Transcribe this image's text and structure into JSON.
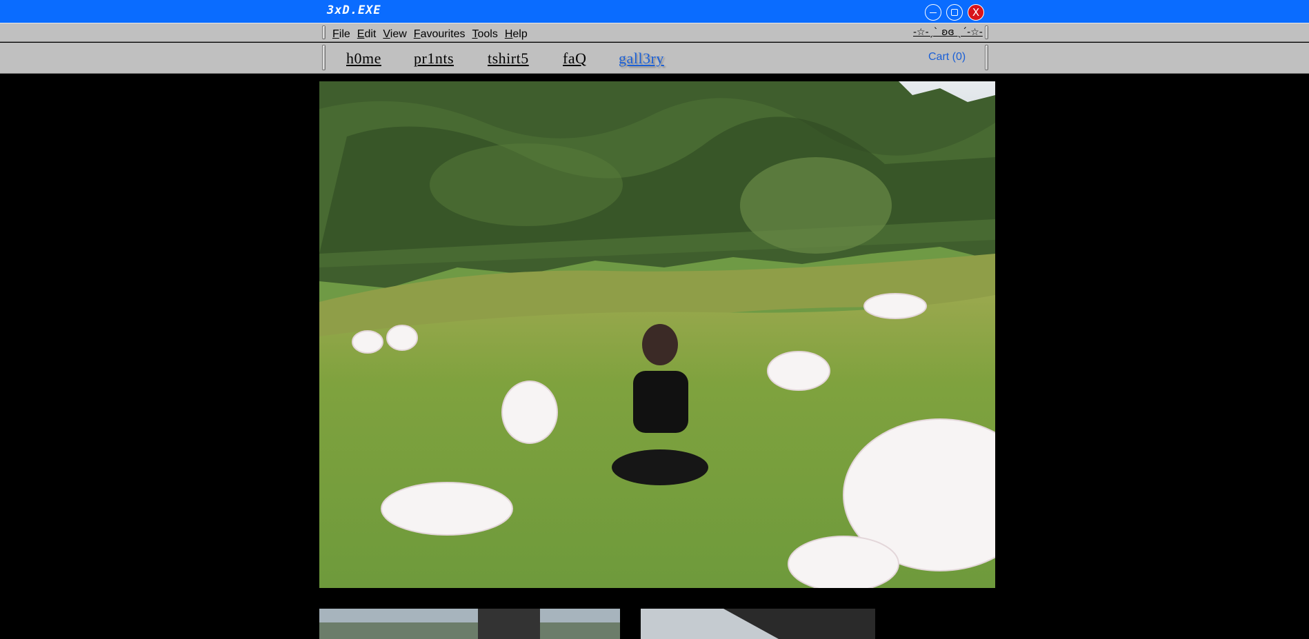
{
  "window": {
    "title": "3xD.EXE",
    "minimize_glyph": "",
    "close_glyph": "X"
  },
  "menubar": {
    "items": [
      {
        "accel": "F",
        "rest": "ile"
      },
      {
        "accel": "E",
        "rest": "dit"
      },
      {
        "accel": "V",
        "rest": "iew"
      },
      {
        "accel": "F",
        "rest": "avourites"
      },
      {
        "accel": "T",
        "rest": "ools"
      },
      {
        "accel": "H",
        "rest": "elp"
      }
    ],
    "decoration": "-☆-ˏˋ ʚɞ ˎˊ-☆-"
  },
  "nav": {
    "home": "h0me",
    "prints": "pr1nts",
    "tshirts": "tshirt5",
    "faq": "faQ",
    "gallery": "gall3ry",
    "cart": "Cart (0)"
  },
  "colors": {
    "titlebar": "#0a6cff",
    "chrome": "#c0c0c0",
    "link_active": "#1a5fd6",
    "close_button": "#d8141a"
  }
}
